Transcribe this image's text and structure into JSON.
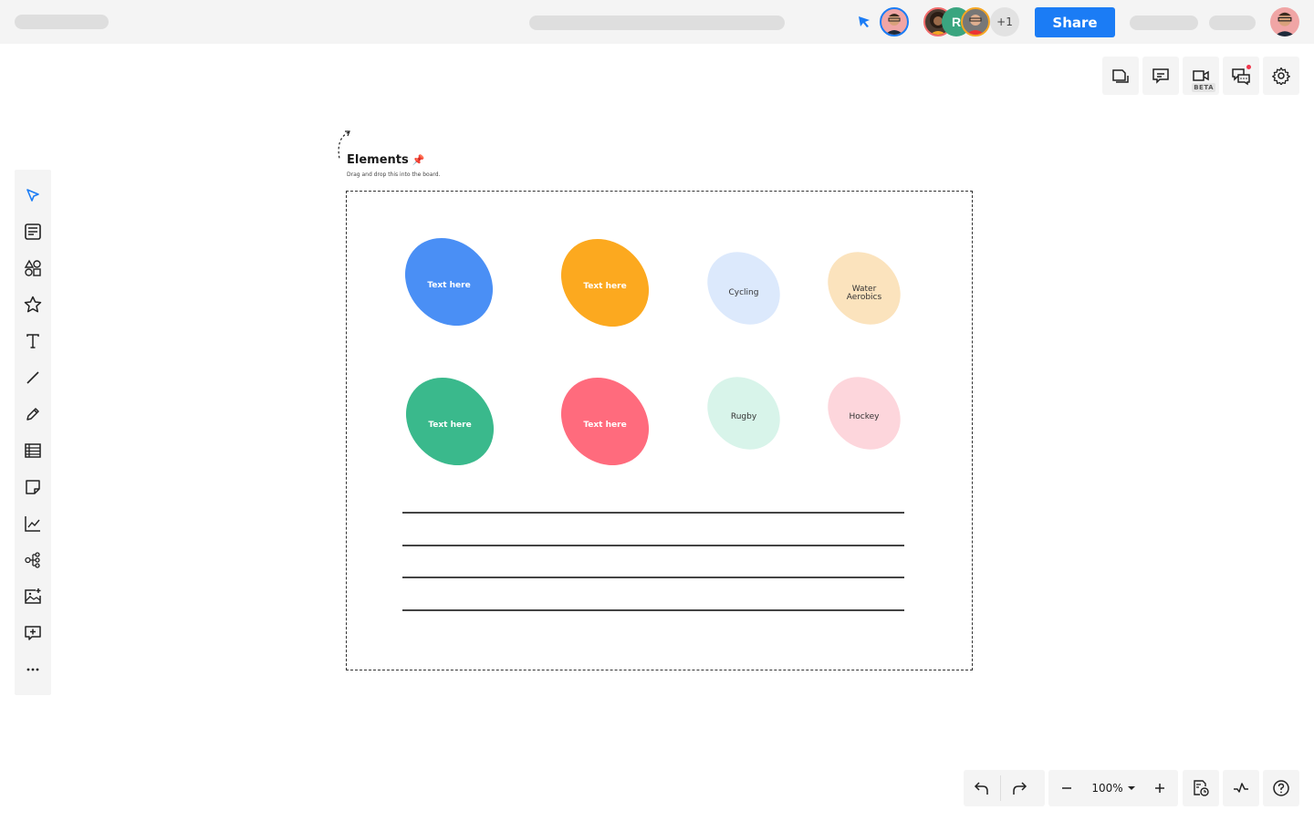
{
  "topbar": {
    "share_label": "Share",
    "collaborators_initial": "R",
    "collaborators_extra": "+1",
    "colors": {
      "share": "#1b7cf5",
      "cursor": "#1b7cf5"
    }
  },
  "right_toolbar": {
    "items": [
      {
        "name": "pages",
        "icon": "pages-icon"
      },
      {
        "name": "comments",
        "icon": "comment-icon"
      },
      {
        "name": "video",
        "icon": "video-icon",
        "badge": "BETA"
      },
      {
        "name": "chat",
        "icon": "chat-icon",
        "notification": true
      },
      {
        "name": "settings",
        "icon": "gear-icon"
      }
    ]
  },
  "sidebar": {
    "items": [
      {
        "name": "select",
        "icon": "cursor-icon",
        "active": true
      },
      {
        "name": "templates",
        "icon": "template-icon"
      },
      {
        "name": "shapes",
        "icon": "shapes-icon"
      },
      {
        "name": "stickers",
        "icon": "star-icon"
      },
      {
        "name": "text",
        "icon": "text-icon"
      },
      {
        "name": "line",
        "icon": "line-icon"
      },
      {
        "name": "pen",
        "icon": "pencil-icon"
      },
      {
        "name": "table",
        "icon": "table-icon"
      },
      {
        "name": "sticky-note",
        "icon": "sticky-note-icon"
      },
      {
        "name": "chart",
        "icon": "chart-icon"
      },
      {
        "name": "mind-map",
        "icon": "mindmap-icon"
      },
      {
        "name": "image",
        "icon": "image-add-icon"
      },
      {
        "name": "add-comment",
        "icon": "comment-add-icon"
      },
      {
        "name": "more",
        "icon": "more-icon"
      }
    ]
  },
  "frame": {
    "title": "Elements",
    "title_emoji": "📌",
    "subtitle": "Drag and drop this into the board.",
    "blobs": [
      {
        "label": "Text here",
        "color": "#4a8ff5",
        "text_color": "#ffffff",
        "bold": true
      },
      {
        "label": "Text here",
        "color": "#fca91f",
        "text_color": "#ffffff",
        "bold": true
      },
      {
        "label": "Cycling",
        "color": "#dce9fc",
        "text_color": "#333333",
        "bold": false
      },
      {
        "label": "Water\nAerobics",
        "color": "#fbe3bd",
        "text_color": "#333333",
        "bold": false
      },
      {
        "label": "Text here",
        "color": "#3ab98c",
        "text_color": "#ffffff",
        "bold": true
      },
      {
        "label": "Text here",
        "color": "#ff6b7d",
        "text_color": "#ffffff",
        "bold": true
      },
      {
        "label": "Rugby",
        "color": "#d8f4ea",
        "text_color": "#333333",
        "bold": false
      },
      {
        "label": "Hockey",
        "color": "#fdd6dc",
        "text_color": "#333333",
        "bold": false
      }
    ],
    "lines_count": 4
  },
  "bottom_toolbar": {
    "zoom_level": "100%",
    "undo": "undo-icon",
    "redo": "redo-icon",
    "zoom_out": "minus-icon",
    "zoom_in": "plus-icon",
    "history": "history-icon",
    "activity": "activity-icon",
    "help": "help-icon"
  }
}
